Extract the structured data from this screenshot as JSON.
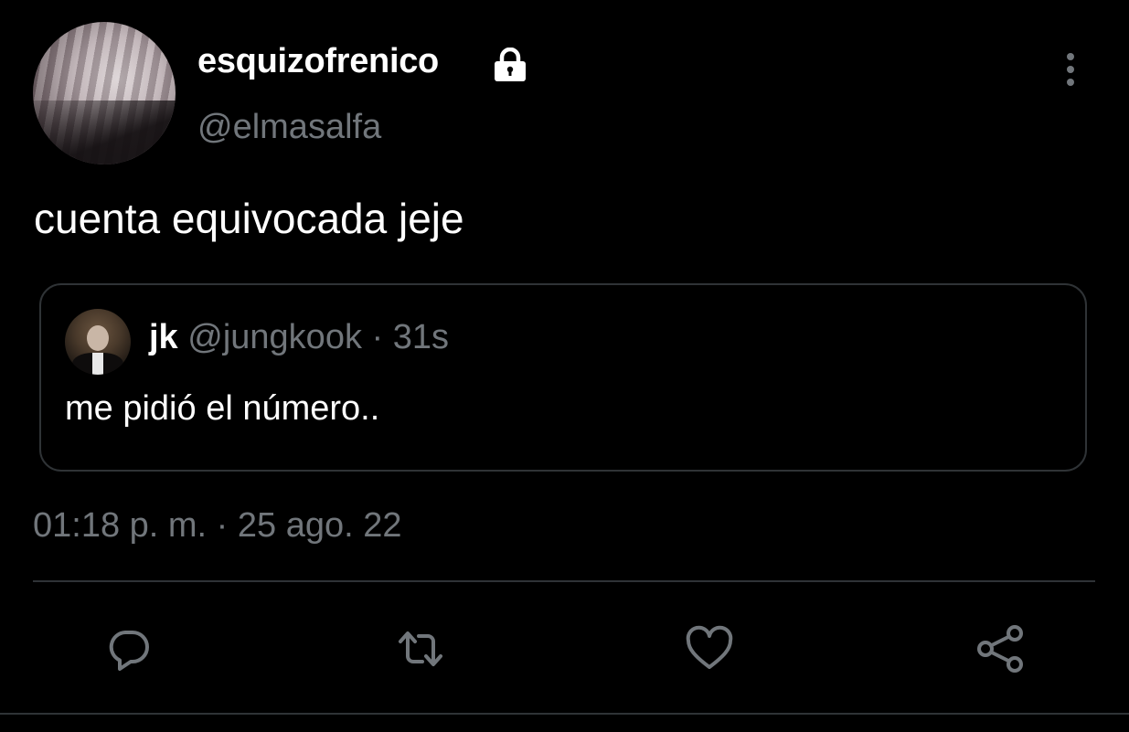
{
  "tweet": {
    "display_name": "esquizofrenico",
    "handle": "@elmasalfa",
    "text": "cuenta equivocada jeje",
    "timestamp": "01:18 p. m. · 25 ago. 22"
  },
  "quote": {
    "name": "jk",
    "handle": "@jungkook",
    "separator": "·",
    "time": "31s",
    "text": "me pidió el número.."
  },
  "icons": {
    "lock": "lock-icon",
    "more": "more-vertical-icon",
    "reply": "reply-icon",
    "retweet": "retweet-icon",
    "like": "heart-icon",
    "share": "share-icon"
  },
  "colors": {
    "background": "#000000",
    "primary_text": "#ffffff",
    "secondary_text": "#71767b",
    "border": "#2f3336"
  }
}
